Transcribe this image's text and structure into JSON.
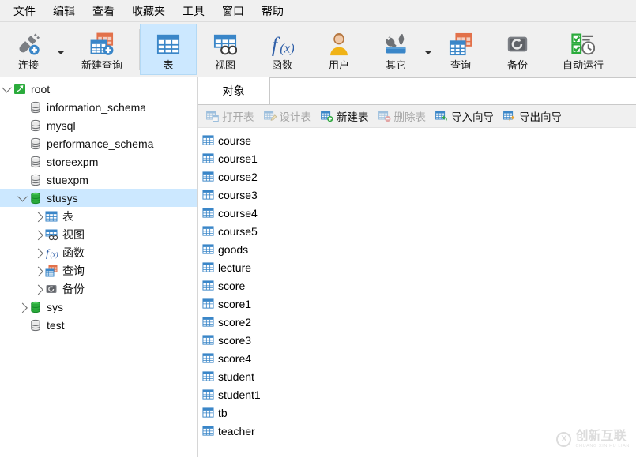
{
  "menubar": {
    "items": [
      {
        "label": "文件",
        "name": "menu-file"
      },
      {
        "label": "编辑",
        "name": "menu-edit"
      },
      {
        "label": "查看",
        "name": "menu-view"
      },
      {
        "label": "收藏夹",
        "name": "menu-favorites"
      },
      {
        "label": "工具",
        "name": "menu-tools"
      },
      {
        "label": "窗口",
        "name": "menu-window"
      },
      {
        "label": "帮助",
        "name": "menu-help"
      }
    ]
  },
  "ribbon": {
    "buttons": [
      {
        "label": "连接",
        "icon": "connection-icon",
        "name": "ribbon-connection",
        "selected": false,
        "caret": true
      },
      {
        "label": "新建查询",
        "icon": "new-query-icon",
        "name": "ribbon-new-query",
        "selected": false,
        "caret": false
      },
      {
        "label": "表",
        "icon": "table-icon",
        "name": "ribbon-table",
        "selected": true,
        "caret": false
      },
      {
        "label": "视图",
        "icon": "view-icon",
        "name": "ribbon-view",
        "selected": false,
        "caret": false
      },
      {
        "label": "函数",
        "icon": "function-icon",
        "name": "ribbon-function",
        "selected": false,
        "caret": false
      },
      {
        "label": "用户",
        "icon": "user-icon",
        "name": "ribbon-user",
        "selected": false,
        "caret": false
      },
      {
        "label": "其它",
        "icon": "others-icon",
        "name": "ribbon-others",
        "selected": false,
        "caret": true
      },
      {
        "label": "查询",
        "icon": "query-icon",
        "name": "ribbon-query",
        "selected": false,
        "caret": false
      },
      {
        "label": "备份",
        "icon": "backup-icon",
        "name": "ribbon-backup",
        "selected": false,
        "caret": false
      },
      {
        "label": "自动运行",
        "icon": "automation-icon",
        "name": "ribbon-automation",
        "selected": false,
        "caret": false
      }
    ]
  },
  "tree": {
    "nodes": [
      {
        "label": "root",
        "icon": "connection-green-icon",
        "indent": 0,
        "twisty": "down",
        "selected": false,
        "name": "tree-node-root"
      },
      {
        "label": "information_schema",
        "icon": "database-gray-icon",
        "indent": 1,
        "twisty": "none",
        "selected": false,
        "name": "tree-node-information-schema"
      },
      {
        "label": "mysql",
        "icon": "database-gray-icon",
        "indent": 1,
        "twisty": "none",
        "selected": false,
        "name": "tree-node-mysql"
      },
      {
        "label": "performance_schema",
        "icon": "database-gray-icon",
        "indent": 1,
        "twisty": "none",
        "selected": false,
        "name": "tree-node-performance-schema"
      },
      {
        "label": "storeexpm",
        "icon": "database-gray-icon",
        "indent": 1,
        "twisty": "none",
        "selected": false,
        "name": "tree-node-storeexpm"
      },
      {
        "label": "stuexpm",
        "icon": "database-gray-icon",
        "indent": 1,
        "twisty": "none",
        "selected": false,
        "name": "tree-node-stuexpm"
      },
      {
        "label": "stusys",
        "icon": "database-green-icon",
        "indent": 1,
        "twisty": "down",
        "selected": true,
        "name": "tree-node-stusys"
      },
      {
        "label": "表",
        "icon": "table-icon",
        "indent": 2,
        "twisty": "right",
        "selected": false,
        "name": "tree-node-tables"
      },
      {
        "label": "视图",
        "icon": "view-icon",
        "indent": 2,
        "twisty": "right",
        "selected": false,
        "name": "tree-node-views"
      },
      {
        "label": "函数",
        "icon": "function-icon",
        "indent": 2,
        "twisty": "right",
        "selected": false,
        "name": "tree-node-functions"
      },
      {
        "label": "查询",
        "icon": "query-icon",
        "indent": 2,
        "twisty": "right",
        "selected": false,
        "name": "tree-node-queries"
      },
      {
        "label": "备份",
        "icon": "backup-icon",
        "indent": 2,
        "twisty": "right",
        "selected": false,
        "name": "tree-node-backups"
      },
      {
        "label": "sys",
        "icon": "database-green-icon",
        "indent": 1,
        "twisty": "right",
        "selected": false,
        "name": "tree-node-sys"
      },
      {
        "label": "test",
        "icon": "database-gray-icon",
        "indent": 1,
        "twisty": "none",
        "selected": false,
        "name": "tree-node-test"
      }
    ]
  },
  "main": {
    "tabs": [
      {
        "label": "对象",
        "active": true,
        "name": "tab-objects"
      }
    ],
    "object_toolbar": [
      {
        "label": "打开表",
        "icon": "open-table-icon",
        "disabled": true,
        "name": "open-table-button"
      },
      {
        "label": "设计表",
        "icon": "design-table-icon",
        "disabled": true,
        "name": "design-table-button"
      },
      {
        "label": "新建表",
        "icon": "new-table-icon",
        "disabled": false,
        "name": "new-table-button"
      },
      {
        "label": "删除表",
        "icon": "delete-table-icon",
        "disabled": true,
        "name": "delete-table-button"
      },
      {
        "label": "导入向导",
        "icon": "import-wizard-icon",
        "disabled": false,
        "name": "import-wizard-button"
      },
      {
        "label": "导出向导",
        "icon": "export-wizard-icon",
        "disabled": false,
        "name": "export-wizard-button"
      }
    ],
    "tables": [
      {
        "label": "course",
        "icon": "table-icon"
      },
      {
        "label": "course1",
        "icon": "table-icon"
      },
      {
        "label": "course2",
        "icon": "table-icon"
      },
      {
        "label": "course3",
        "icon": "table-icon"
      },
      {
        "label": "course4",
        "icon": "table-icon"
      },
      {
        "label": "course5",
        "icon": "table-icon"
      },
      {
        "label": "goods",
        "icon": "table-icon"
      },
      {
        "label": "lecture",
        "icon": "table-icon"
      },
      {
        "label": "score",
        "icon": "table-icon"
      },
      {
        "label": "score1",
        "icon": "table-icon"
      },
      {
        "label": "score2",
        "icon": "table-icon"
      },
      {
        "label": "score3",
        "icon": "table-icon"
      },
      {
        "label": "score4",
        "icon": "table-icon"
      },
      {
        "label": "student",
        "icon": "table-icon"
      },
      {
        "label": "student1",
        "icon": "table-icon"
      },
      {
        "label": "tb",
        "icon": "table-icon"
      },
      {
        "label": "teacher",
        "icon": "table-icon"
      }
    ]
  },
  "watermark": {
    "logo": "X",
    "cn": "创新互联",
    "en": "CHUANG XIN HU LIAN"
  },
  "colors": {
    "accent": "#3a86c8",
    "selection": "#cce8ff",
    "chrome": "#f0f0f0",
    "green": "#2bab3c",
    "orange": "#e2714a"
  }
}
